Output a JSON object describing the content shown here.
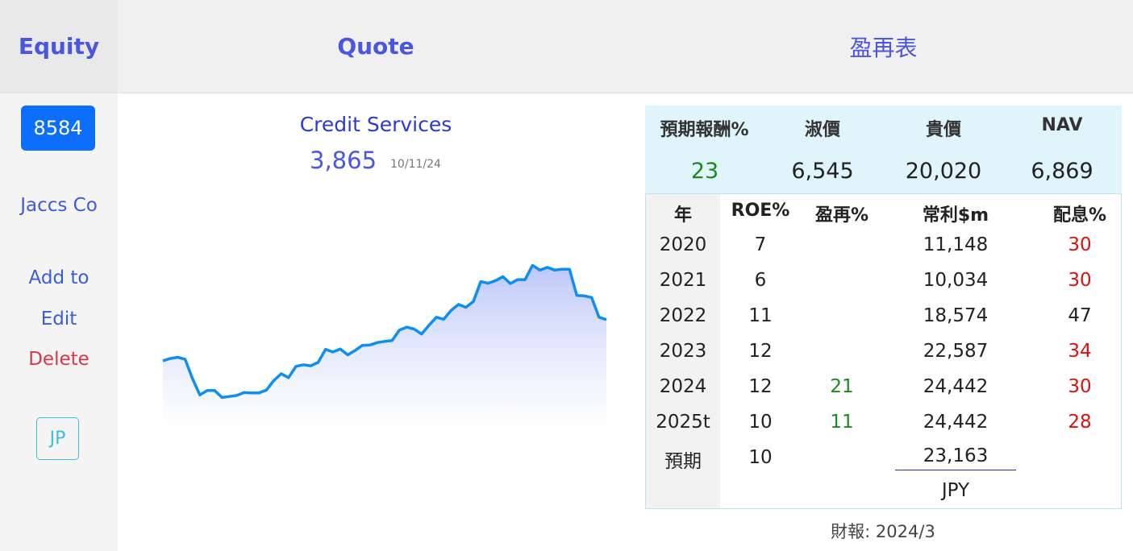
{
  "header": {
    "equity": "Equity",
    "quote": "Quote",
    "table_title": "盈再表"
  },
  "sidebar": {
    "ticker": "8584",
    "company": "Jaccs Co",
    "add": "Add to",
    "edit": "Edit",
    "delete": "Delete",
    "market": "JP"
  },
  "quote": {
    "sector": "Credit Services",
    "price": "3,865",
    "date": "10/11/24"
  },
  "summary": {
    "labels": [
      "預期報酬%",
      "淑價",
      "貴價",
      "NAV"
    ],
    "values": [
      "23",
      "6,545",
      "20,020",
      "6,869"
    ]
  },
  "table": {
    "headers": [
      "年",
      "ROE%",
      "盈再%",
      "常利$m",
      "配息%"
    ],
    "rows": [
      {
        "year": "2020",
        "roe": "7",
        "reinvest": "",
        "profit": "11,148",
        "payout": "30"
      },
      {
        "year": "2021",
        "roe": "6",
        "reinvest": "",
        "profit": "10,034",
        "payout": "30"
      },
      {
        "year": "2022",
        "roe": "11",
        "reinvest": "",
        "profit": "18,574",
        "payout": "47"
      },
      {
        "year": "2023",
        "roe": "12",
        "reinvest": "",
        "profit": "22,587",
        "payout": "34"
      },
      {
        "year": "2024",
        "roe": "12",
        "reinvest": "21",
        "profit": "24,442",
        "payout": "30"
      },
      {
        "year": "2025t",
        "roe": "10",
        "reinvest": "11",
        "profit": "24,442",
        "payout": "28"
      },
      {
        "year": "預期",
        "roe": "10",
        "reinvest": "",
        "profit": "23,163",
        "payout": ""
      }
    ],
    "currency": "JPY",
    "report": "財報: 2024/3"
  },
  "colors": {
    "accent": "#4a55e0",
    "primary_button": "#0d6efd",
    "danger": "#dc3545",
    "payout_red": "#e01010",
    "positive_green": "#1a8a1a",
    "line": "#0d8ef0"
  },
  "chart_data": {
    "type": "area",
    "title": "",
    "xlabel": "",
    "ylabel": "",
    "series": [
      {
        "values": [
          3120,
          3132,
          3138,
          3128,
          3030,
          2948,
          2970,
          2970,
          2935,
          2940,
          2945,
          2960,
          2958,
          2958,
          2972,
          3020,
          3055,
          3035,
          3092,
          3100,
          3095,
          3112,
          3178,
          3165,
          3180,
          3150,
          3172,
          3198,
          3200,
          3212,
          3218,
          3222,
          3275,
          3290,
          3280,
          3255,
          3300,
          3340,
          3330,
          3375,
          3405,
          3390,
          3420,
          3520,
          3512,
          3525,
          3545,
          3510,
          3530,
          3530,
          3602,
          3578,
          3592,
          3578,
          3582,
          3582,
          3450,
          3448,
          3440,
          3340,
          3328
        ]
      }
    ],
    "grid": false,
    "legend": "none"
  }
}
